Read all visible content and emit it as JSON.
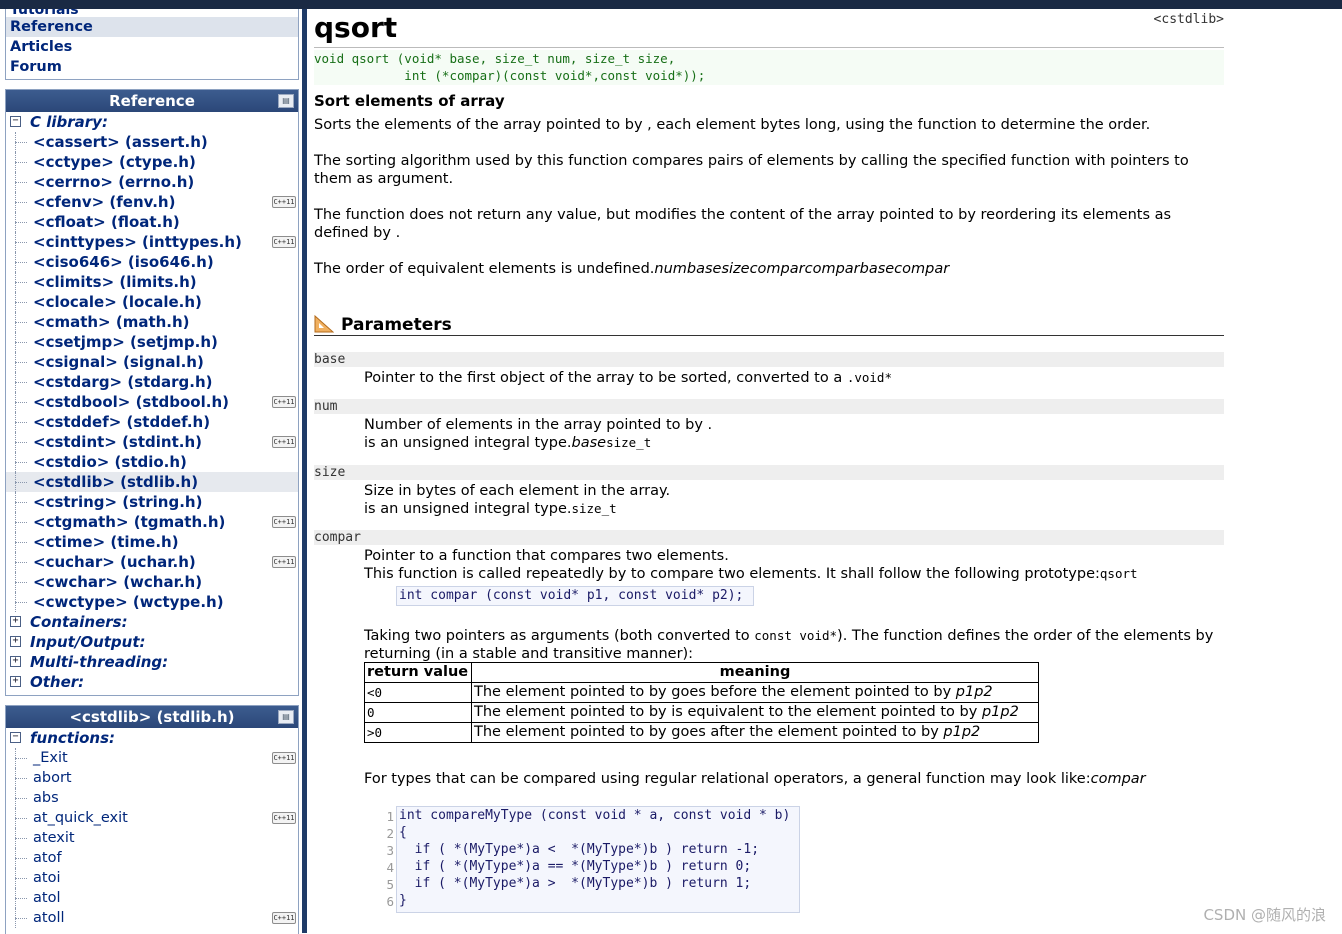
{
  "top_links": [
    "Tutorials",
    "Reference",
    "Articles",
    "Forum"
  ],
  "reference_panel": {
    "title": "Reference",
    "c_library_label": "C library:",
    "headers": [
      {
        "label": "<cassert> (assert.h)",
        "cpp": false
      },
      {
        "label": "<cctype> (ctype.h)",
        "cpp": false
      },
      {
        "label": "<cerrno> (errno.h)",
        "cpp": false
      },
      {
        "label": "<cfenv> (fenv.h)",
        "cpp": true
      },
      {
        "label": "<cfloat> (float.h)",
        "cpp": false
      },
      {
        "label": "<cinttypes> (inttypes.h)",
        "cpp": true
      },
      {
        "label": "<ciso646> (iso646.h)",
        "cpp": false
      },
      {
        "label": "<climits> (limits.h)",
        "cpp": false
      },
      {
        "label": "<clocale> (locale.h)",
        "cpp": false
      },
      {
        "label": "<cmath> (math.h)",
        "cpp": false
      },
      {
        "label": "<csetjmp> (setjmp.h)",
        "cpp": false
      },
      {
        "label": "<csignal> (signal.h)",
        "cpp": false
      },
      {
        "label": "<cstdarg> (stdarg.h)",
        "cpp": false
      },
      {
        "label": "<cstdbool> (stdbool.h)",
        "cpp": true
      },
      {
        "label": "<cstddef> (stddef.h)",
        "cpp": false
      },
      {
        "label": "<cstdint> (stdint.h)",
        "cpp": true
      },
      {
        "label": "<cstdio> (stdio.h)",
        "cpp": false
      },
      {
        "label": "<cstdlib> (stdlib.h)",
        "cpp": false
      },
      {
        "label": "<cstring> (string.h)",
        "cpp": false
      },
      {
        "label": "<ctgmath> (tgmath.h)",
        "cpp": true
      },
      {
        "label": "<ctime> (time.h)",
        "cpp": false
      },
      {
        "label": "<cuchar> (uchar.h)",
        "cpp": true
      },
      {
        "label": "<cwchar> (wchar.h)",
        "cpp": false
      },
      {
        "label": "<cwctype> (wctype.h)",
        "cpp": false
      }
    ],
    "selected_header": "<cstdlib> (stdlib.h)",
    "categories": [
      "Containers:",
      "Input/Output:",
      "Multi-threading:",
      "Other:"
    ],
    "expander_open": "−",
    "expander_closed": "+",
    "cpp_badge": "C++11",
    "box_icon_label": "▤"
  },
  "cstdlib_panel": {
    "title": "<cstdlib> (stdlib.h)",
    "functions_label": "functions:",
    "functions": [
      {
        "label": "_Exit",
        "cpp": true
      },
      {
        "label": "abort",
        "cpp": false
      },
      {
        "label": "abs",
        "cpp": false
      },
      {
        "label": "at_quick_exit",
        "cpp": true
      },
      {
        "label": "atexit",
        "cpp": false
      },
      {
        "label": "atof",
        "cpp": false
      },
      {
        "label": "atoi",
        "cpp": false
      },
      {
        "label": "atol",
        "cpp": false
      },
      {
        "label": "atoll",
        "cpp": true
      }
    ]
  },
  "main": {
    "title": "qsort",
    "header_tag": "<cstdlib>",
    "prototype": "void qsort (void* base, size_t num, size_t size,\n            int (*compar)(const void*,const void*));",
    "subtitle": "Sort elements of array",
    "p1": "Sorts the elements of the array pointed to by , each element bytes long, using the function to determine the order.",
    "p2": "The sorting algorithm used by this function compares pairs of elements by calling the specified function with pointers to them as argument.",
    "p3": "The function does not return any value, but modifies the content of the array pointed to by reordering its elements as defined by .",
    "p4_text": "The order of equivalent elements is undefined.",
    "p4_italic": "numbasesizecomparcomparbasecompar",
    "params_heading": "Parameters",
    "params": {
      "base_name": "base",
      "base_desc_text": "Pointer to the first object of the array to be sorted, converted to a ",
      "base_desc_code": ".void*",
      "num_name": "num",
      "num_line1": "Number of elements in the array pointed to by .",
      "num_line2_text": "is an unsigned integral type.",
      "num_line2_italic": "base",
      "num_line2_code": "size_t",
      "size_name": "size",
      "size_line1": "Size in bytes of each element in the array.",
      "size_line2_text": "is an unsigned integral type.",
      "size_line2_code": "size_t",
      "compar_name": "compar",
      "compar_line1": "Pointer to a function that compares two elements.",
      "compar_line2_text": "This function is called repeatedly by to compare two elements. It shall follow the following prototype:",
      "compar_line2_code": "qsort",
      "compar_proto": "int compar (const void* p1, const void* p2);",
      "taking_text_a": "Taking two pointers as arguments (both converted to ",
      "taking_code": "const void*",
      "taking_text_b": "). The function defines the order of the elements by returning (in a stable and transitive manner):"
    },
    "table": {
      "headers": [
        "return value",
        "meaning"
      ],
      "rows": [
        {
          "rv": "<0",
          "meaning": "The element pointed to by goes before the element pointed to by ",
          "tail": "p1p2"
        },
        {
          "rv": "0",
          "meaning": "The element pointed to by is equivalent to the element pointed to by ",
          "tail": "p1p2"
        },
        {
          "rv": ">0",
          "meaning": "The element pointed to by goes after the element pointed to by ",
          "tail": "p1p2"
        }
      ]
    },
    "general_text": "For types that can be compared using regular relational operators, a general function may look like:",
    "general_italic": "compar",
    "code_lines": [
      {
        "n": "1",
        "code": "int compareMyType (const void * a, const void * b)"
      },
      {
        "n": "2",
        "code": "{"
      },
      {
        "n": "3",
        "code": "  if ( *(MyType*)a <  *(MyType*)b ) return -1;"
      },
      {
        "n": "4",
        "code": "  if ( *(MyType*)a == *(MyType*)b ) return 0;"
      },
      {
        "n": "5",
        "code": "  if ( *(MyType*)a >  *(MyType*)b ) return 1;"
      },
      {
        "n": "6",
        "code": "}"
      }
    ]
  },
  "watermark": "CSDN @随风的浪"
}
